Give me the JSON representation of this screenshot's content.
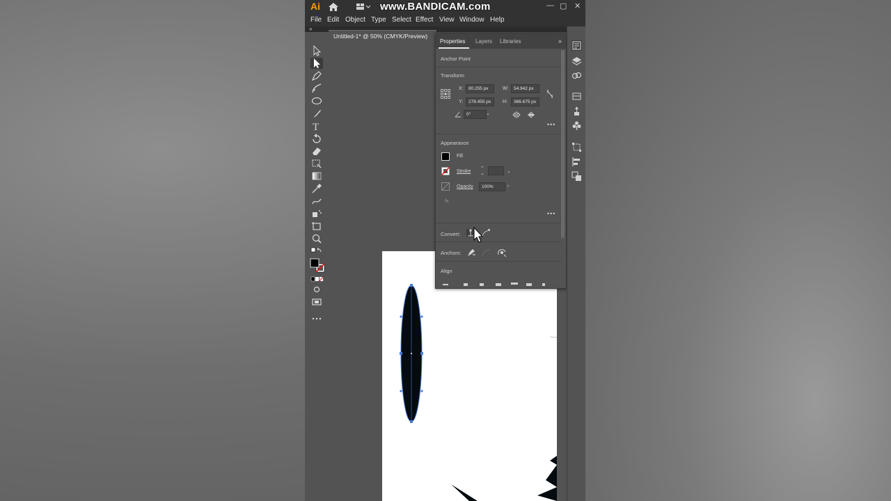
{
  "app": {
    "logo": "Ai",
    "watermark": "www.BANDICAM.com",
    "window_controls": {
      "minimize": "—",
      "maximize": "▢",
      "close": "✕"
    }
  },
  "menu": [
    "File",
    "Edit",
    "Object",
    "Type",
    "Select",
    "Effect",
    "View",
    "Window",
    "Help"
  ],
  "document": {
    "tab_title": "Untitled-1* @ 50% (CMYK/Preview)"
  },
  "panel": {
    "tabs": [
      "Properties",
      "Layers",
      "Libraries"
    ],
    "active_tab": "Properties",
    "selection_type": "Anchor Point",
    "transform": {
      "title": "Transform",
      "x_label": "X:",
      "x": "80.255 px",
      "y_label": "Y:",
      "y": "278.455 px",
      "w_label": "W:",
      "w": "54.942 px",
      "h_label": "H:",
      "h": "366.675 px",
      "angle": "0°"
    },
    "appearance": {
      "title": "Appearance",
      "fill_label": "Fill",
      "stroke_label": "Stroke",
      "opacity_label": "Opacity",
      "opacity_value": "100%",
      "fx_label": "fx."
    },
    "convert_label": "Convert:",
    "anchors_label": "Anchors:",
    "align_title": "Align"
  },
  "colors": {
    "ui_dark": "#323232",
    "ui_mid": "#535353",
    "accent_logo": "#ff9a00",
    "anchor_blue": "#4a7bd6",
    "shape_fill": "#050b0f"
  }
}
